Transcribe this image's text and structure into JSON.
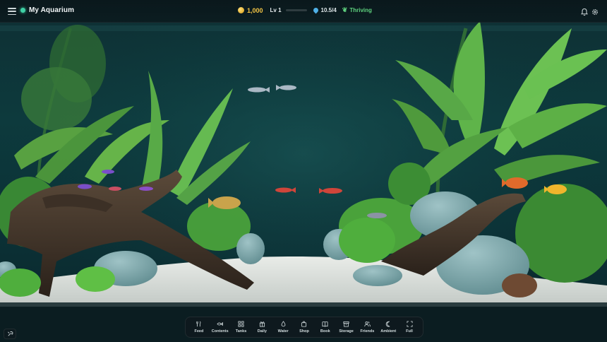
{
  "header": {
    "tank_name": "My Aquarium",
    "coins": "1,000",
    "level": "Lv 1",
    "xp_progress": 0.0,
    "capacity": "10.5/4",
    "status": "Thriving"
  },
  "toolbar": {
    "items": [
      {
        "label": "Feed",
        "icon": "fork-knife-icon"
      },
      {
        "label": "Contents",
        "icon": "fish-icon"
      },
      {
        "label": "Tanks",
        "icon": "grid-icon"
      },
      {
        "label": "Daily",
        "icon": "gift-icon"
      },
      {
        "label": "Water",
        "icon": "droplet-icon"
      },
      {
        "label": "Shop",
        "icon": "bag-icon"
      },
      {
        "label": "Book",
        "icon": "book-icon"
      },
      {
        "label": "Storage",
        "icon": "archive-icon"
      },
      {
        "label": "Friends",
        "icon": "users-icon"
      },
      {
        "label": "Ambient",
        "icon": "moon-icon"
      },
      {
        "label": "Full",
        "icon": "expand-icon"
      }
    ]
  },
  "colors": {
    "accent": "#3fd1a5",
    "coin": "#f2c445",
    "status": "#5fd37f",
    "water": "#0f3a3c"
  }
}
